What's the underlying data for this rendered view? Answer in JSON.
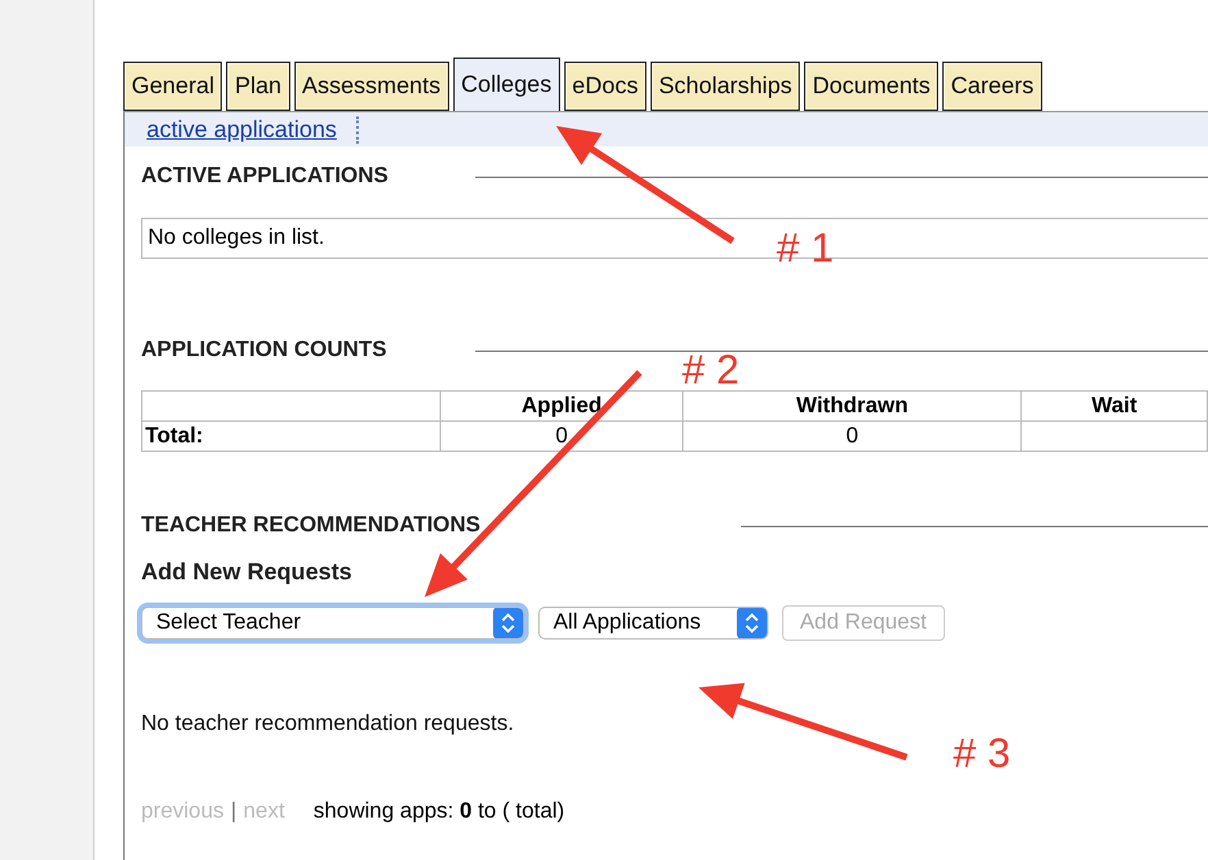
{
  "tabs": [
    {
      "label": "General",
      "selected": false
    },
    {
      "label": "Plan",
      "selected": false
    },
    {
      "label": "Assessments",
      "selected": false
    },
    {
      "label": "Colleges",
      "selected": true
    },
    {
      "label": "eDocs",
      "selected": false
    },
    {
      "label": "Scholarships",
      "selected": false
    },
    {
      "label": "Documents",
      "selected": false
    },
    {
      "label": "Careers",
      "selected": false
    }
  ],
  "subnav": {
    "link": "active applications"
  },
  "active_applications": {
    "heading": "ACTIVE APPLICATIONS",
    "empty": "No colleges in list."
  },
  "application_counts": {
    "heading": "APPLICATION COUNTS",
    "columns": [
      "",
      "Applied",
      "Withdrawn",
      "Wait"
    ],
    "rows": [
      [
        "Total:",
        "0",
        "0",
        ""
      ]
    ]
  },
  "teacher_recommendations": {
    "heading": "TEACHER RECOMMENDATIONS",
    "subheading": "Add New Requests",
    "teacher_select": {
      "value": "Select Teacher",
      "focused": true
    },
    "application_select": {
      "value": "All Applications"
    },
    "add_button": {
      "label": "Add Request",
      "disabled": true
    },
    "empty": "No teacher recommendation requests."
  },
  "pager": {
    "previous": "previous",
    "separator": "|",
    "next": "next",
    "status": "showing apps: **0** to ( total)"
  },
  "annotations": [
    "# 1",
    "# 2",
    "# 3"
  ]
}
